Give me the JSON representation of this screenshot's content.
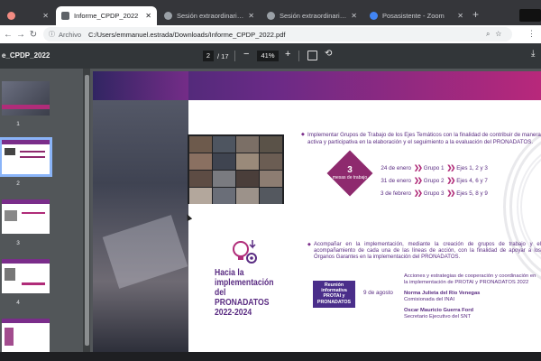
{
  "browser": {
    "tabs": [
      {
        "label": "",
        "color": "#f28b82",
        "active": false
      },
      {
        "label": "Informe_CPDP_2022",
        "color": "#5f6368",
        "active": true
      },
      {
        "label": "Sesión extraordinaria CVPDY",
        "color": "#9aa0a6",
        "active": false
      },
      {
        "label": "Sesión extraordinaria CVPDY",
        "color": "#9aa0a6",
        "active": false
      },
      {
        "label": "Posasistente - Zoom",
        "color": "#4285f4",
        "active": false
      }
    ],
    "badge": "",
    "address_label": "Archivo",
    "url": "C:/Users/emmanuel.estrada/Downloads/Informe_CPDP_2022.pdf"
  },
  "pdf_toolbar": {
    "title": "e_CPDP_2022",
    "page": "2",
    "total": "/ 17",
    "zoom": "41%"
  },
  "thumbnails": [
    {
      "num": "1",
      "selected": false
    },
    {
      "num": "2",
      "selected": true
    },
    {
      "num": "3",
      "selected": false
    },
    {
      "num": "4",
      "selected": false
    },
    {
      "num": "5",
      "selected": false
    }
  ],
  "slide": {
    "bullet1": "Implementar Grupos de Trabajo de los Ejes Temáticos con la finalidad de contribuir de manera activa y participativa en la elaboración y el seguimiento a la evaluación del PRONADATOS.",
    "mesas": {
      "number": "3",
      "label": "mesas de trabajo"
    },
    "groups": [
      {
        "date": "24 de enero",
        "group": "Grupo 1",
        "ejes": "Ejes 1, 2 y 3"
      },
      {
        "date": "31 de enero",
        "group": "Grupo 2",
        "ejes": "Ejes 4, 6 y 7"
      },
      {
        "date": "3 de febrero",
        "group": "Grupo 3",
        "ejes": "Ejes 5, 8 y 9"
      }
    ],
    "hacia": "Hacia la implementación del PRONADATOS 2022-2024",
    "bullet2": "Acompañar en la implementación, mediante la creación de grupos de trabajo y el acompañamiento de cada una de las líneas de acción, con la finalidad de apoyar a los Órganos Garantes en la implementación del PRONADATOS.",
    "reunion": "Reunión informativa PROTAI y PRONADATOS",
    "reunion_date": "9 de agosto",
    "acciones": "Acciones y estrategias de cooperación y coordinación en la implementación de PROTAI y PRONADATOS 2022",
    "people": [
      {
        "name": "Norma Julieta del Río Venegas",
        "role": "Comisionada del INAI"
      },
      {
        "name": "Oscar Mauricio Guerra Ford",
        "role": "Secretario Ejecutivo del SNT"
      }
    ]
  },
  "colors": {
    "accent": "#5a2c82",
    "magenta": "#b02c79",
    "chrome_dark": "#35363a",
    "pdf_bg": "#525659"
  }
}
